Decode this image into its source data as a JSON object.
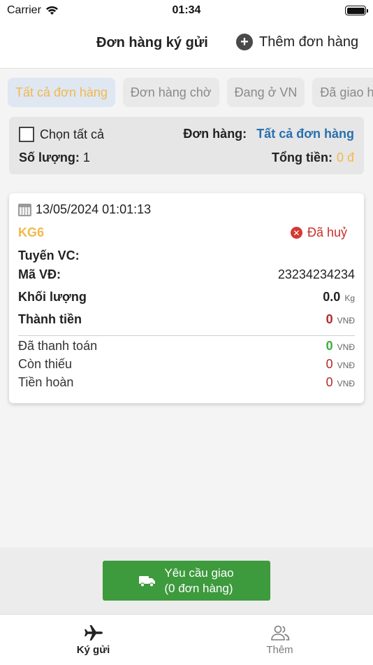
{
  "status_bar": {
    "carrier": "Carrier",
    "time": "01:34"
  },
  "header": {
    "title": "Đơn hàng ký gửi",
    "add_label": "Thêm đơn hàng"
  },
  "tabs": [
    {
      "label": "Tất cả đơn hàng",
      "active": true
    },
    {
      "label": "Đơn hàng chờ",
      "active": false
    },
    {
      "label": "Đang ở VN",
      "active": false
    },
    {
      "label": "Đã giao hàng",
      "active": false
    }
  ],
  "summary": {
    "select_all": "Chọn tất cả",
    "order_label": "Đơn hàng:",
    "order_value": "Tất cả đơn hàng",
    "qty_label": "Số lượng:",
    "qty_value": "1",
    "total_label": "Tổng tiền:",
    "total_value": "0 đ"
  },
  "order": {
    "date": "13/05/2024 01:01:13",
    "code": "KG6",
    "status": "Đã huỷ",
    "route_label": "Tuyến VC:",
    "route_value": "",
    "tracking_label": "Mã VĐ:",
    "tracking_value": "23234234234",
    "weight_label": "Khối lượng",
    "weight_value": "0.0",
    "weight_unit": "Kg",
    "amount_label": "Thành tiền",
    "amount_value": "0",
    "paid_label": "Đã thanh toán",
    "paid_value": "0",
    "missing_label": "Còn thiếu",
    "missing_value": "0",
    "refund_label": "Tiền hoàn",
    "refund_value": "0",
    "currency": "VNĐ"
  },
  "request_button": {
    "line1": "Yêu cầu giao",
    "line2": "(0 đơn hàng)"
  },
  "tab_bar": [
    {
      "label": "Ký gửi",
      "icon": "airplane-icon",
      "active": true
    },
    {
      "label": "Thêm",
      "icon": "users-icon",
      "active": false
    }
  ],
  "colors": {
    "accent_yellow": "#f2b94a",
    "link_blue": "#2a6fb0",
    "danger_red": "#c8302c",
    "success_green": "#3d9a3d"
  }
}
